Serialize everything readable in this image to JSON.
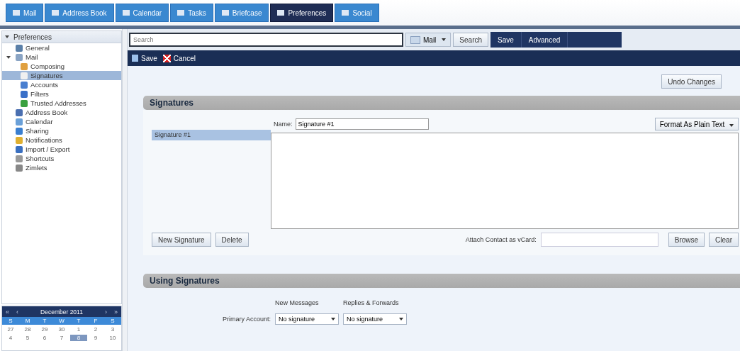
{
  "app_tabs": [
    {
      "label": "Mail",
      "selected": false
    },
    {
      "label": "Address Book",
      "selected": false
    },
    {
      "label": "Calendar",
      "selected": false
    },
    {
      "label": "Tasks",
      "selected": false
    },
    {
      "label": "Briefcase",
      "selected": false
    },
    {
      "label": "Preferences",
      "selected": true
    },
    {
      "label": "Social",
      "selected": false
    }
  ],
  "sidebar": {
    "title": "Preferences",
    "expanded": true,
    "items": [
      {
        "label": "General",
        "selected": false
      },
      {
        "label": "Mail",
        "selected": false,
        "expanded": true,
        "children": [
          {
            "label": "Composing",
            "selected": false
          },
          {
            "label": "Signatures",
            "selected": true
          },
          {
            "label": "Accounts",
            "selected": false
          },
          {
            "label": "Filters",
            "selected": false
          },
          {
            "label": "Trusted Addresses",
            "selected": false
          }
        ]
      },
      {
        "label": "Address Book",
        "selected": false
      },
      {
        "label": "Calendar",
        "selected": false
      },
      {
        "label": "Sharing",
        "selected": false
      },
      {
        "label": "Notifications",
        "selected": false
      },
      {
        "label": "Import / Export",
        "selected": false
      },
      {
        "label": "Shortcuts",
        "selected": false
      },
      {
        "label": "Zimlets",
        "selected": false
      }
    ]
  },
  "mini_calendar": {
    "prev_year": "«",
    "prev_month": "‹",
    "month": "December 2011",
    "next_month": "›",
    "next_year": "»",
    "weekdays": [
      "S",
      "M",
      "T",
      "W",
      "T",
      "F",
      "S"
    ],
    "weeks": [
      [
        {
          "day": "27",
          "selected": false
        },
        {
          "day": "28",
          "selected": false
        },
        {
          "day": "29",
          "selected": false
        },
        {
          "day": "30",
          "selected": false
        },
        {
          "day": "1",
          "selected": false
        },
        {
          "day": "2",
          "selected": false
        },
        {
          "day": "3",
          "selected": false
        }
      ],
      [
        {
          "day": "4",
          "selected": false
        },
        {
          "day": "5",
          "selected": false
        },
        {
          "day": "6",
          "selected": false
        },
        {
          "day": "7",
          "selected": false
        },
        {
          "day": "8",
          "selected": true
        },
        {
          "day": "9",
          "selected": false
        },
        {
          "day": "10",
          "selected": false
        }
      ]
    ]
  },
  "search": {
    "placeholder": "Search",
    "scope": "Mail",
    "search_button": "Search",
    "save_button": "Save",
    "advanced_button": "Advanced"
  },
  "toolbar": {
    "save": "Save",
    "cancel": "Cancel"
  },
  "undo_button": "Undo Changes",
  "signatures": {
    "title": "Signatures",
    "list": [
      {
        "label": "Signature #1",
        "selected": true
      }
    ],
    "name_label": "Name:",
    "name_value": "Signature #1",
    "format": "Format As Plain Text",
    "new_button": "New Signature",
    "delete_button": "Delete",
    "vcard_label": "Attach Contact as vCard:",
    "browse_button": "Browse",
    "clear_button": "Clear"
  },
  "using": {
    "title": "Using Signatures",
    "col_new": "New Messages",
    "col_replies": "Replies & Forwards",
    "row_label": "Primary Account:",
    "new_value": "No signature",
    "replies_value": "No signature"
  }
}
